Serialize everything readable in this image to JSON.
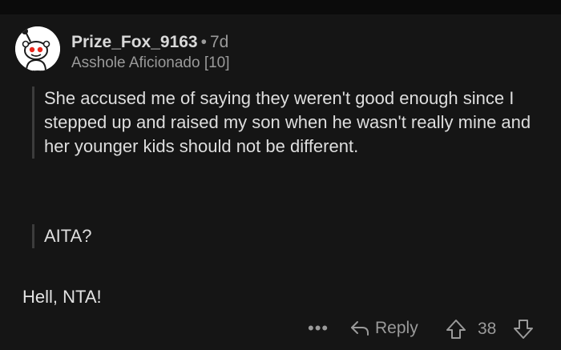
{
  "comment": {
    "username": "Prize_Fox_9163",
    "separator": "•",
    "age": "7d",
    "flair": "Asshole Aficionado [10]",
    "quotes": [
      "She accused me of saying they weren't good enough since I stepped up and raised my son when he wasn't really mine and her younger kids should not be different.",
      "AITA?"
    ],
    "body": "Hell, NTA!"
  },
  "actions": {
    "more_label": "•••",
    "reply_label": "Reply",
    "score": "38"
  },
  "icons": {
    "avatar": "reddit-snoo-avatar-icon",
    "more": "more-options-icon",
    "reply": "reply-arrow-icon",
    "upvote": "upvote-arrow-icon",
    "downvote": "downvote-arrow-icon"
  },
  "colors": {
    "background": "#151515",
    "text": "#d7dadc",
    "muted": "#9a9a9a",
    "quote_bar": "#3c3c3c"
  }
}
